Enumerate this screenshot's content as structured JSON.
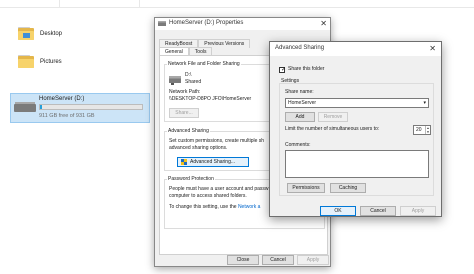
{
  "explorer": {
    "folders": [
      {
        "label": "Desktop"
      },
      {
        "label": "Pictures"
      }
    ],
    "drive": {
      "name": "HomeServer (D:)",
      "free_text": "911 GB free of 931 GB",
      "used_fraction": 0.02
    }
  },
  "properties": {
    "title": "HomeServer (D:) Properties",
    "tabs_row1": [
      "ReadyBoost",
      "Previous Versions"
    ],
    "tabs_row2": [
      "General",
      "Tools"
    ],
    "network_section": {
      "heading": "Network File and Folder Sharing",
      "drive_label": "D:\\",
      "drive_status": "Shared",
      "path_label": "Network Path:",
      "path_value": "\\\\DESKTOP-D8PO JFO\\HomeServer",
      "share_button": "Share..."
    },
    "advanced_section": {
      "heading": "Advanced Sharing",
      "text1": "Set custom permissions, create multiple sh",
      "text2": "advanced sharing options.",
      "button": "Advanced Sharing..."
    },
    "password_section": {
      "heading": "Password Protection",
      "text1": "People must have a user account and passw",
      "text2": "computer to access shared folders.",
      "text3_prefix": "To change this setting, use the ",
      "link": "Network a"
    },
    "buttons": {
      "close": "Close",
      "cancel": "Cancel",
      "apply": "Apply"
    }
  },
  "advanced_sharing": {
    "title": "Advanced Sharing",
    "share_checkbox_label": "Share this folder",
    "share_checked": true,
    "settings_label": "Settings",
    "share_name_label": "Share name:",
    "share_name_value": "HomeServer",
    "add_button": "Add",
    "remove_button": "Remove",
    "limit_label": "Limit the number of simultaneous users to:",
    "limit_value": "20",
    "comments_label": "Comments:",
    "permissions_button": "Permissions",
    "caching_button": "Caching",
    "ok_button": "OK",
    "cancel_button": "Cancel",
    "apply_button": "Apply"
  }
}
